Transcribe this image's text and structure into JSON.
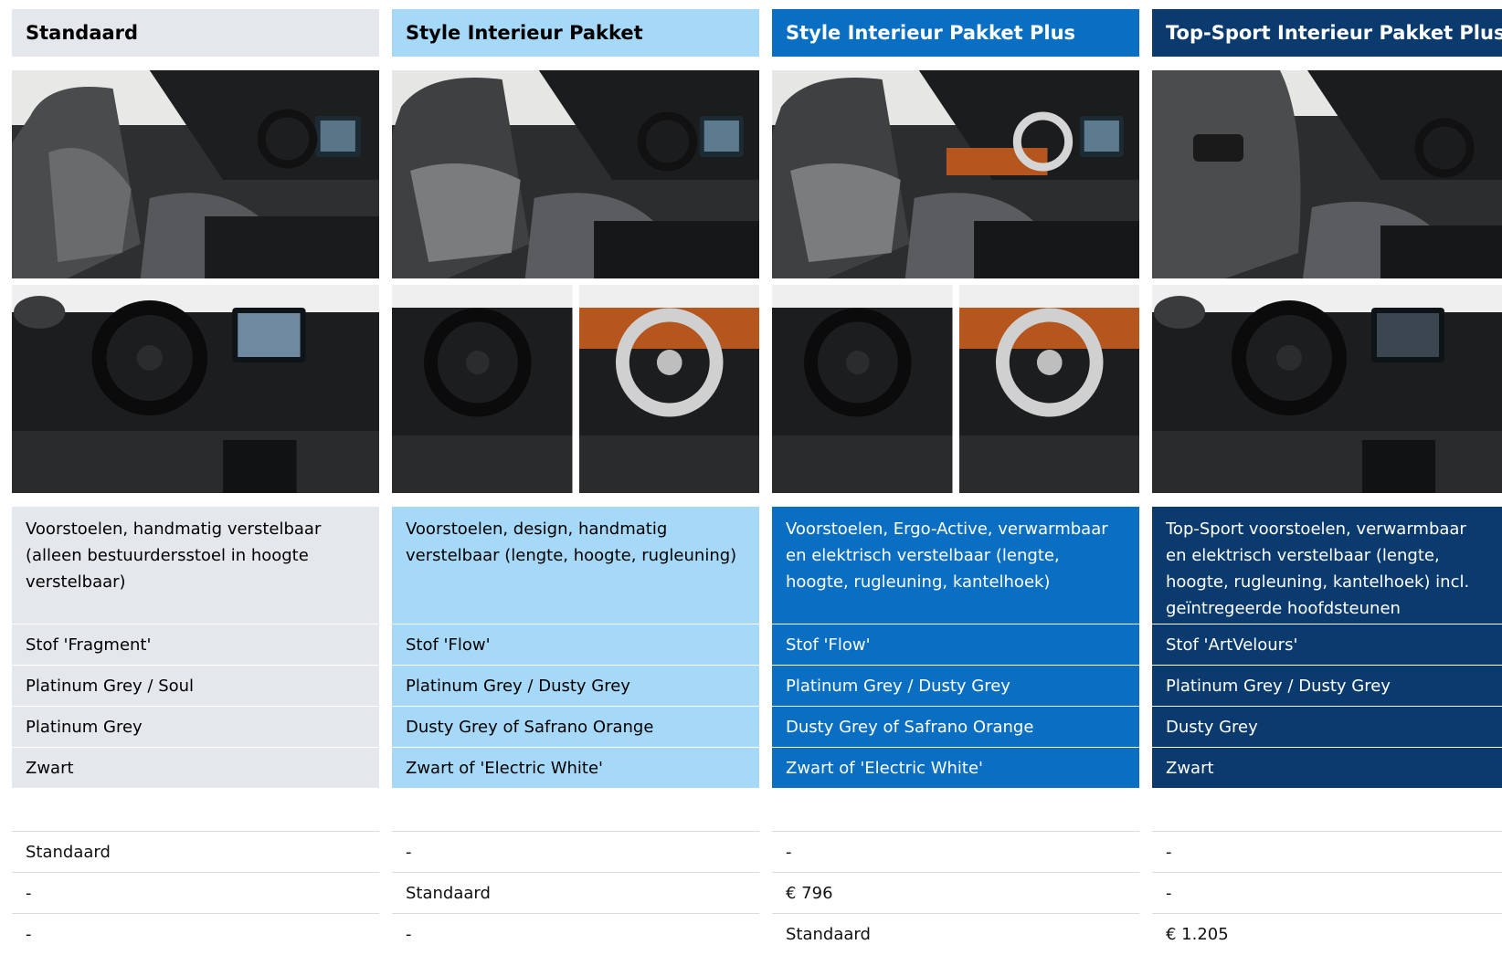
{
  "packages": [
    {
      "title": "Standaard",
      "seat_desc": "Voorstoelen, handmatig verstelbaar (alleen bestuurdersstoel in hoogte verstelbaar)",
      "upholstery": "Stof 'Fragment'",
      "color_combo": "Platinum Grey / Soul",
      "dash_color": "Platinum Grey",
      "steering_color": "Zwart",
      "prices": [
        "Standaard",
        "-",
        "-"
      ]
    },
    {
      "title": "Style Interieur Pakket",
      "seat_desc": "Voorstoelen, design, handmatig verstelbaar (lengte, hoogte, rugleuning)",
      "upholstery": "Stof 'Flow'",
      "color_combo": "Platinum Grey / Dusty Grey",
      "dash_color": "Dusty Grey of Safrano Orange",
      "steering_color": "Zwart of 'Electric White'",
      "prices": [
        "-",
        "Standaard",
        "-"
      ]
    },
    {
      "title": "Style Interieur Pakket Plus",
      "seat_desc": "Voorstoelen, Ergo-Active, verwarmbaar en elektrisch verstelbaar (lengte, hoogte, rugleuning, kantelhoek)",
      "upholstery": "Stof 'Flow'",
      "color_combo": "Platinum Grey / Dusty Grey",
      "dash_color": "Dusty Grey of Safrano Orange",
      "steering_color": "Zwart of 'Electric White'",
      "prices": [
        "-",
        "€ 796",
        "Standaard"
      ]
    },
    {
      "title": "Top-Sport Interieur Pakket Plus",
      "seat_desc": "Top-Sport voorstoelen, verwarmbaar en elektrisch verstelbaar (lengte, hoogte, rugleuning, kantelhoek) incl. geïntregeerde hoofdsteunen",
      "upholstery": "Stof 'ArtVelours'",
      "color_combo": "Platinum Grey / Dusty Grey",
      "dash_color": "Dusty Grey",
      "steering_color": "Zwart",
      "prices": [
        "-",
        "-",
        "€ 1.205"
      ]
    }
  ],
  "colors": {
    "standaard": "#e4e8ec",
    "style": "#a6d9f7",
    "style_plus": "#0a6fc2",
    "top_sport": "#0b3b6e",
    "accent_orange": "#b5561e"
  }
}
